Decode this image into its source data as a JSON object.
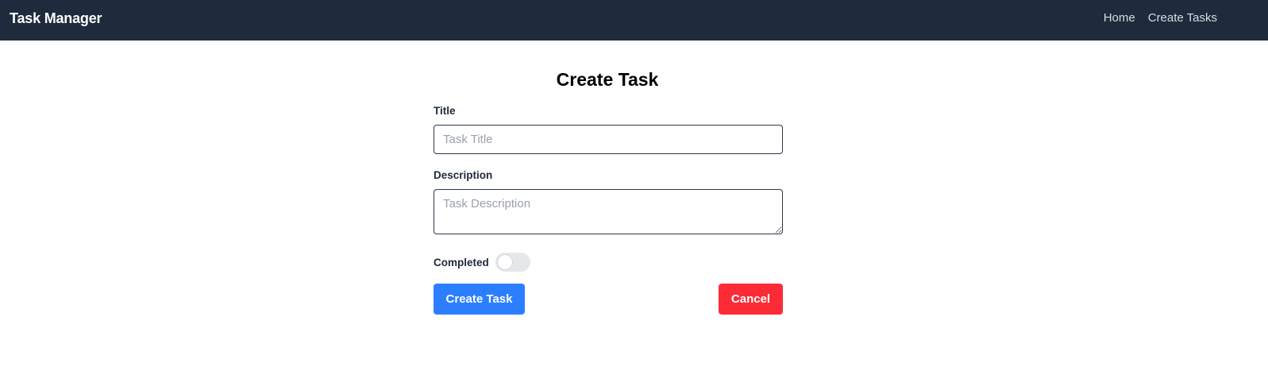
{
  "navbar": {
    "brand": "Task Manager",
    "links": [
      {
        "label": "Home"
      },
      {
        "label": "Create Tasks"
      }
    ]
  },
  "page": {
    "title": "Create Task"
  },
  "form": {
    "title_label": "Title",
    "title_placeholder": "Task Title",
    "title_value": "",
    "description_label": "Description",
    "description_placeholder": "Task Description",
    "description_value": "",
    "completed_label": "Completed",
    "completed": false,
    "submit_label": "Create Task",
    "cancel_label": "Cancel"
  },
  "colors": {
    "navbar_bg": "#1f2a3c",
    "primary_button": "#2b7fff",
    "cancel_button": "#fb2c36",
    "toggle_off": "#e5e7eb"
  }
}
